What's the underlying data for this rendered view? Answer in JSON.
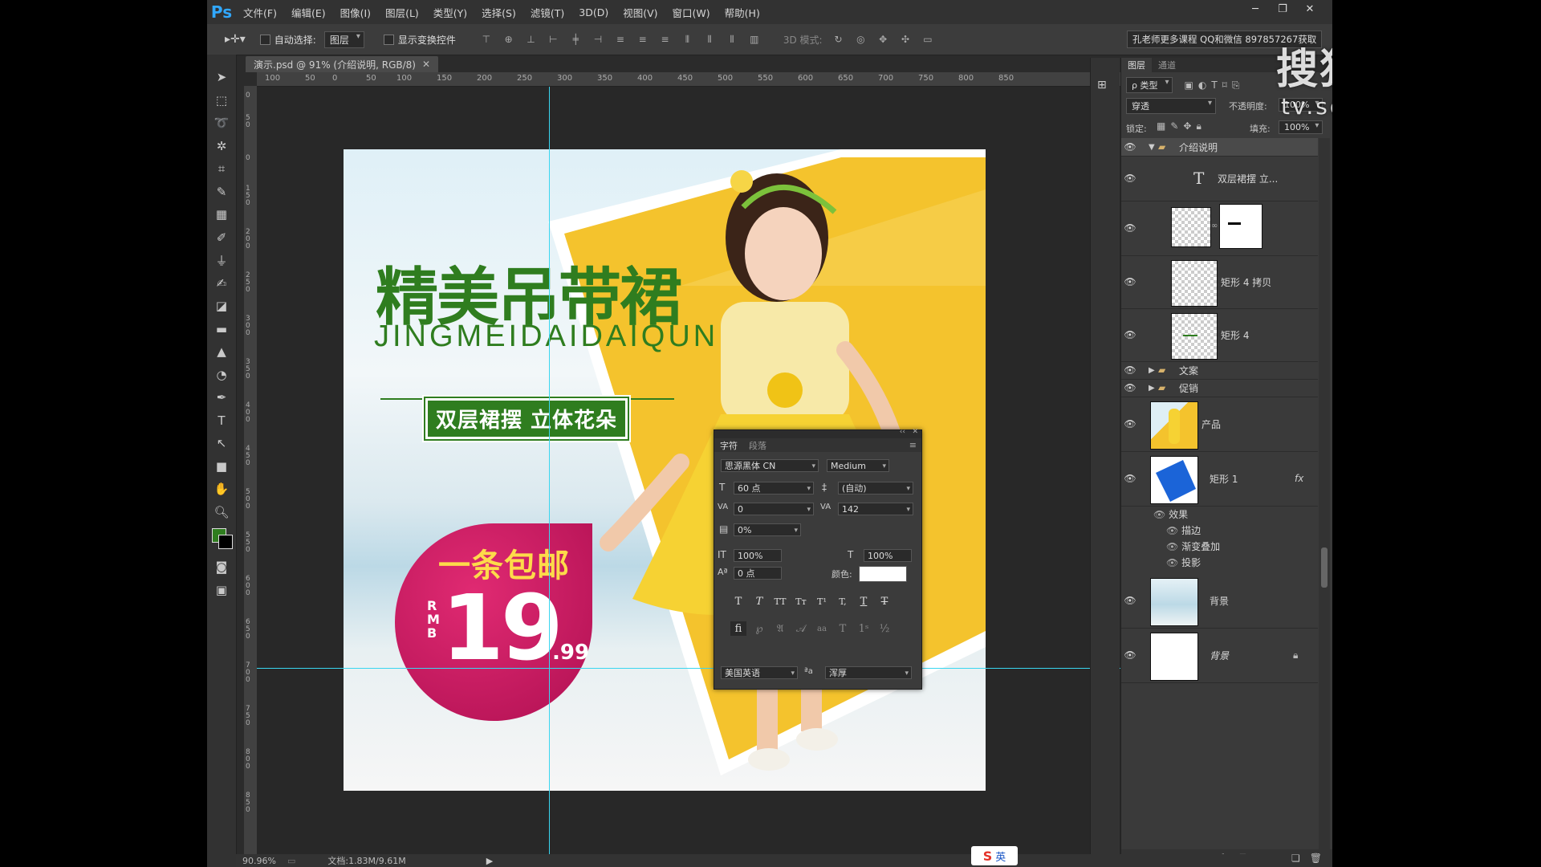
{
  "app": {
    "logo": "Ps"
  },
  "menu": [
    "文件(F)",
    "编辑(E)",
    "图像(I)",
    "图层(L)",
    "类型(Y)",
    "选择(S)",
    "滤镜(T)",
    "3D(D)",
    "视图(V)",
    "窗口(W)",
    "帮助(H)"
  ],
  "options": {
    "auto_select_label": "自动选择:",
    "auto_select_value": "图层",
    "show_transform_label": "显示变换控件",
    "mode3d_label": "3D 模式:",
    "promo_text": "孔老师更多课程 QQ和微信 897857267获取"
  },
  "document": {
    "tab_title": "演示.psd @ 91% (介绍说明, RGB/8)",
    "zoom": "90.96%",
    "doc_info": "文档:1.83M/9.61M",
    "ruler_h": [
      "100",
      "50",
      "0",
      "50",
      "100",
      "150",
      "200",
      "250",
      "300",
      "350",
      "400",
      "450",
      "500",
      "550",
      "600",
      "650",
      "700",
      "750",
      "800",
      "850"
    ],
    "ruler_v": [
      "0",
      "50",
      "0",
      "150",
      "200",
      "250",
      "300",
      "350",
      "400",
      "450",
      "500",
      "550",
      "600",
      "650",
      "700",
      "750",
      "800",
      "850"
    ]
  },
  "artwork": {
    "title": "精美吊带裙",
    "subtitle": "JINGMEIDAIDAIQUN",
    "tagline": "双层裙摆 立体花朵",
    "badge_text": "一条包邮",
    "price_currency": "RMB",
    "price_main": "19",
    "price_decimal": ".99"
  },
  "layers_panel": {
    "tabs": [
      "图层",
      "通道"
    ],
    "filter_label": "ρ 类型",
    "blend_mode": "穿透",
    "opacity_label": "不透明度:",
    "opacity_value": "100%",
    "lock_label": "锁定:",
    "fill_label": "填充:",
    "fill_value": "100%",
    "layers": [
      {
        "name": "介绍说明"
      },
      {
        "name": "双层裙摆 立..."
      },
      {
        "name": ""
      },
      {
        "name": "矩形 4 拷贝"
      },
      {
        "name": "矩形 4"
      },
      {
        "name": "文案"
      },
      {
        "name": "促销"
      },
      {
        "name": "产品"
      },
      {
        "name": "矩形 1"
      },
      {
        "name": "背景"
      },
      {
        "name": "背景"
      }
    ],
    "effects_label": "效果",
    "effects": [
      "描边",
      "渐变叠加",
      "投影"
    ],
    "fx_label": "fx"
  },
  "char_panel": {
    "tabs": [
      "字符",
      "段落"
    ],
    "font": "思源黑体 CN",
    "style": "Medium",
    "size": "60 点",
    "leading": "(自动)",
    "kerning": "0",
    "tracking": "142",
    "tsume": "0%",
    "vscale": "100%",
    "hscale": "100%",
    "baseline": "0 点",
    "color_label": "颜色:",
    "language": "美国英语",
    "aa_label": "ªa",
    "aa": "浑厚",
    "type_buttons": [
      "T",
      "T",
      "TT",
      "Tт",
      "T¹",
      "T,",
      "T",
      "T"
    ]
  },
  "watermark": {
    "brand": "搜狐视频",
    "url": "tv.sohu.com"
  },
  "ime": {
    "label": "英"
  },
  "colors": {
    "accent_green": "#2f7d1f",
    "badge_pink": "#c8165f",
    "yellow": "#f4c32d",
    "price_blue": "#1b64d8"
  }
}
